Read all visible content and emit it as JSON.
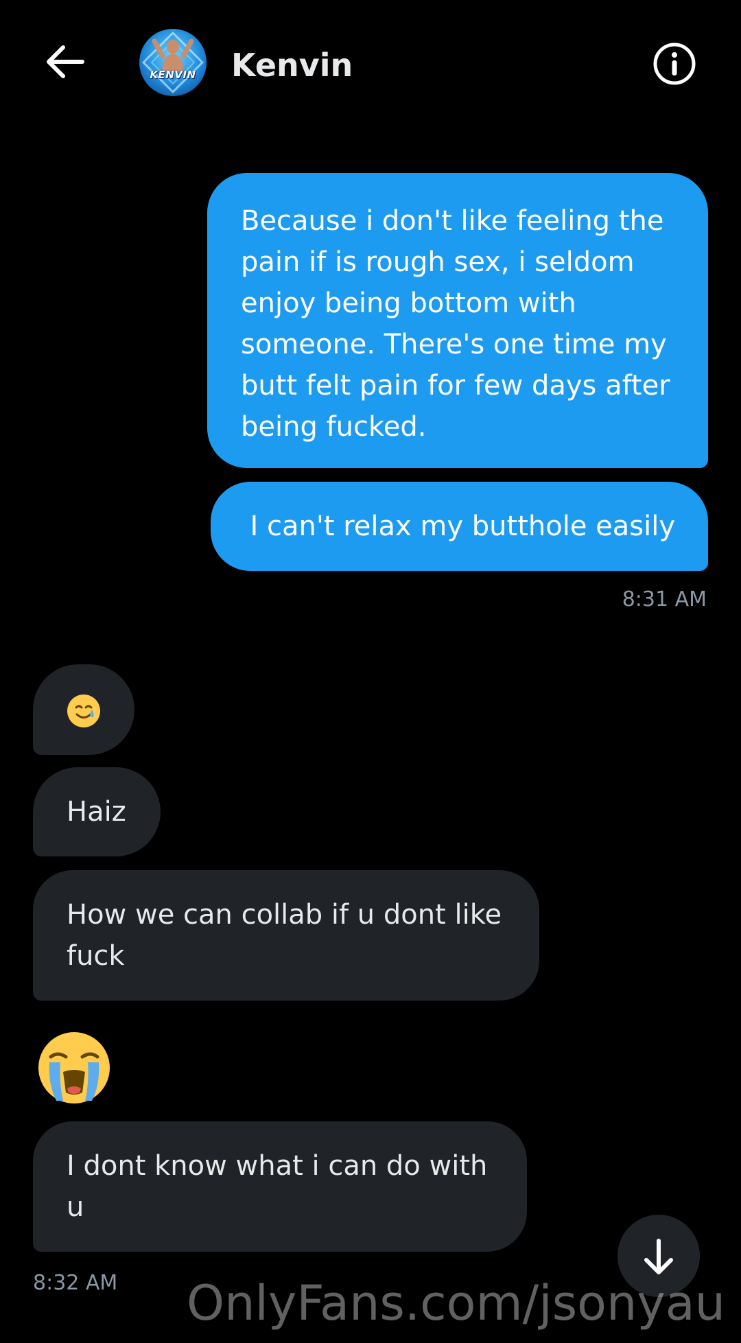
{
  "header": {
    "contact_name": "Kenvin",
    "avatar_text": "KENVIN",
    "back_icon": "arrow-left-icon",
    "info_icon": "info-circle-icon"
  },
  "messages": [
    {
      "direction": "sent",
      "text": "Because i don't  like feeling the pain if is rough sex, i seldom enjoy being bottom with someone. There's one time my butt felt pain for few days after being fucked."
    },
    {
      "direction": "sent",
      "text": "I can't  relax my butthole easily"
    },
    {
      "direction": "received",
      "emoji": "smiling-face-with-tear-emoji"
    },
    {
      "direction": "received",
      "text": "Haiz"
    },
    {
      "direction": "received",
      "text": "How we can collab if u dont like fuck"
    },
    {
      "direction": "received",
      "emoji": "loudly-crying-face-emoji"
    },
    {
      "direction": "received",
      "text": "I dont know what i can do with u"
    }
  ],
  "timestamps": {
    "sent_group": "8:31 AM",
    "received_group": "8:32 AM"
  },
  "scroll_button_icon": "arrow-down-icon",
  "watermark": "OnlyFans.com/jsonyau",
  "colors": {
    "sent_bubble": "#1d9bf0",
    "received_bubble": "#202327",
    "background": "#000000",
    "timestamp": "#8b98a5"
  }
}
